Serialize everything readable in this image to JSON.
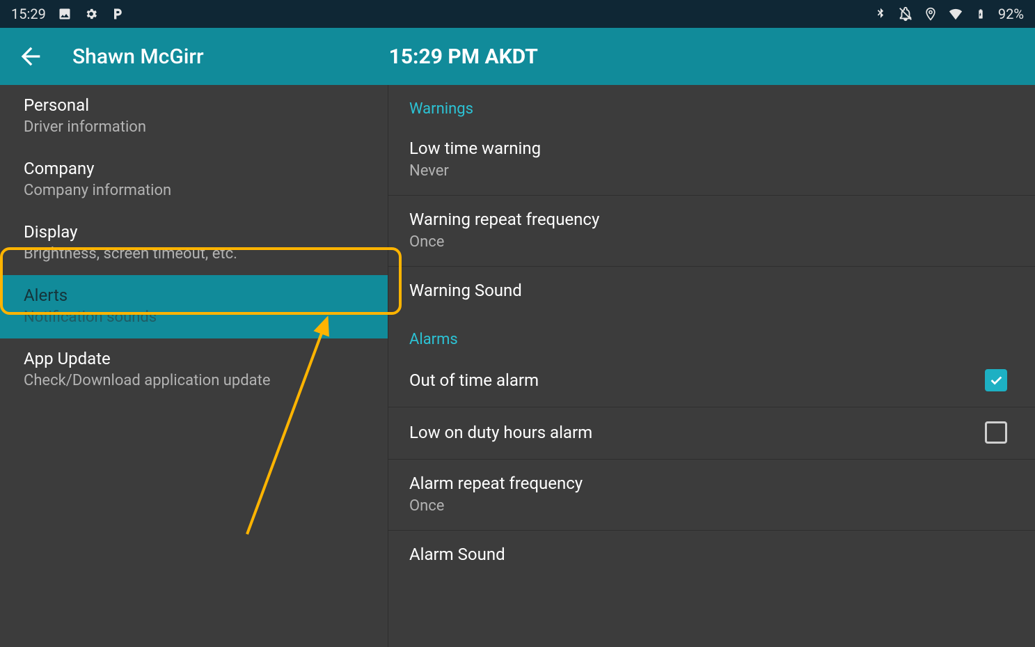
{
  "status_bar": {
    "time": "15:29",
    "battery": "92%"
  },
  "app_bar": {
    "title": "Shawn McGirr",
    "clock": "15:29 PM AKDT"
  },
  "sidebar": {
    "items": [
      {
        "title": "Personal",
        "subtitle": "Driver information"
      },
      {
        "title": "Company",
        "subtitle": "Company information"
      },
      {
        "title": "Display",
        "subtitle": "Brightness, screen timeout, etc."
      },
      {
        "title": "Alerts",
        "subtitle": "Notification sounds"
      },
      {
        "title": "App Update",
        "subtitle": "Check/Download application update"
      }
    ],
    "selected_index": 3
  },
  "right_pane": {
    "warnings_header": "Warnings",
    "alarms_header": "Alarms",
    "items": {
      "low_time_warning": {
        "title": "Low time warning",
        "subtitle": "Never"
      },
      "warning_repeat_freq": {
        "title": "Warning repeat frequency",
        "subtitle": "Once"
      },
      "warning_sound": {
        "title": "Warning Sound"
      },
      "out_of_time_alarm": {
        "title": "Out of time alarm",
        "checked": true
      },
      "low_on_duty_alarm": {
        "title": "Low on duty hours alarm",
        "checked": false
      },
      "alarm_repeat_freq": {
        "title": "Alarm repeat frequency",
        "subtitle": "Once"
      },
      "alarm_sound": {
        "title": "Alarm Sound"
      }
    }
  }
}
